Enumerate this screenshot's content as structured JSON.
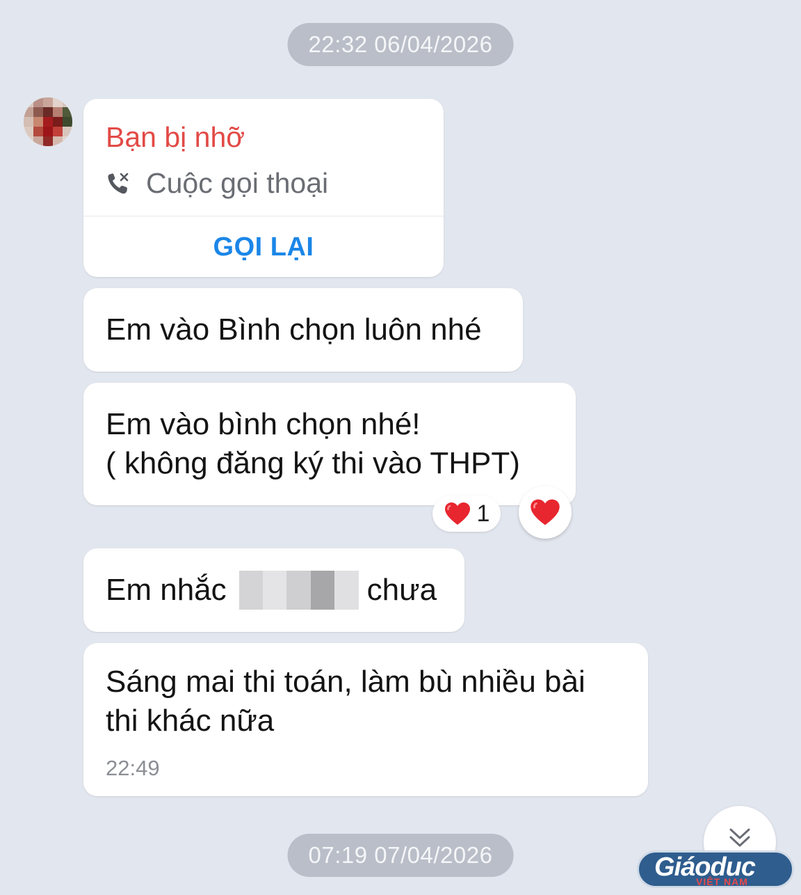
{
  "timestamps": {
    "first": "22:32 06/04/2026",
    "second": "07:19 07/04/2026"
  },
  "missed_call": {
    "title": "Bạn bị nhỡ",
    "subtitle": "Cuộc gọi thoại",
    "action": "GỌI LẠI",
    "icon": "missed-call-icon"
  },
  "messages": [
    {
      "text": "Em vào Bình chọn luôn nhé"
    },
    {
      "line1": "Em vào bình chọn nhé!",
      "line2": "( không đăng ký thi vào THPT)"
    },
    {
      "before": "Em nhắc ",
      "after": "chưa"
    },
    {
      "line1": "Sáng mai thi toán, làm bù nhiều bài",
      "line2": "thi khác nữa",
      "time": "22:49"
    }
  ],
  "reactions": {
    "count": "1",
    "icon": "heart-icon"
  },
  "watermark": {
    "brand": "Giáoduc",
    "sub": "VIỆT NAM"
  },
  "colors": {
    "background": "#e2e6ee",
    "missed_call_red": "#e24a46",
    "link_blue": "#1b86e8",
    "heart_red": "#e8262f"
  }
}
